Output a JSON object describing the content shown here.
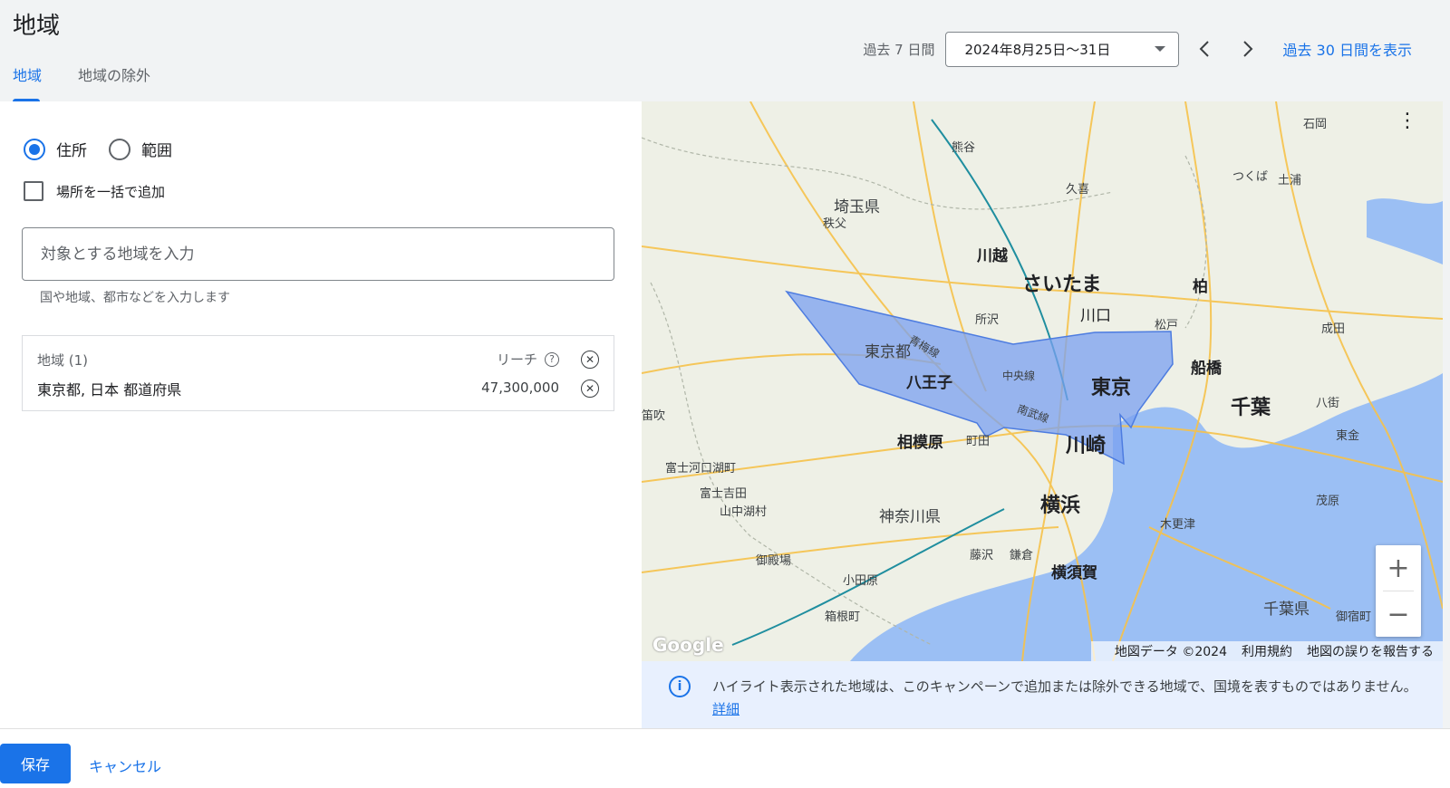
{
  "page": {
    "title": "地域"
  },
  "tabs": [
    {
      "label": "地域"
    },
    {
      "label": "地域の除外"
    }
  ],
  "date": {
    "prefix": "過去 7 日間",
    "range": "2024年8月25日〜31日",
    "show_30": "過去 30 日間を表示"
  },
  "location_type": {
    "address": "住所",
    "radius": "範囲"
  },
  "bulk_add": {
    "label": "場所を一括で追加"
  },
  "search": {
    "placeholder": "対象とする地域を入力",
    "helper": "国や地域、都市などを入力します"
  },
  "locations": {
    "header": "地域 (1)",
    "reach_header": "リーチ",
    "rows": [
      {
        "name": "東京都, 日本 都道府県",
        "reach": "47,300,000"
      }
    ]
  },
  "map": {
    "labels": [
      "熊谷",
      "久喜",
      "埼玉県",
      "秩父",
      "川越",
      "さいたま",
      "所沢",
      "川口",
      "柏",
      "つくば",
      "土浦",
      "石岡",
      "松戸",
      "成田",
      "東京都",
      "八王子",
      "東京",
      "船橋",
      "千葉",
      "八街",
      "相模原",
      "町田",
      "川崎",
      "東金",
      "富士河口湖町",
      "富士吉田",
      "山中湖村",
      "神奈川県",
      "横浜",
      "木更津",
      "茂原",
      "御殿場",
      "藤沢",
      "鎌倉",
      "横須賀",
      "小田原",
      "箱根町",
      "千葉県",
      "御宿町",
      "笛吹",
      "中央線",
      "青梅線",
      "南武線"
    ],
    "google": "Google",
    "footer": {
      "data": "地図データ ©2024",
      "terms": "利用規約",
      "report": "地図の誤りを報告する"
    },
    "highlight_color": "#7aa0f0"
  },
  "info": {
    "text": "ハイライト表示された地域は、このキャンペーンで追加または除外できる地域で、国境を表すものではありません。",
    "link": "詳細"
  },
  "actions": {
    "save": "保存",
    "cancel": "キャンセル"
  }
}
